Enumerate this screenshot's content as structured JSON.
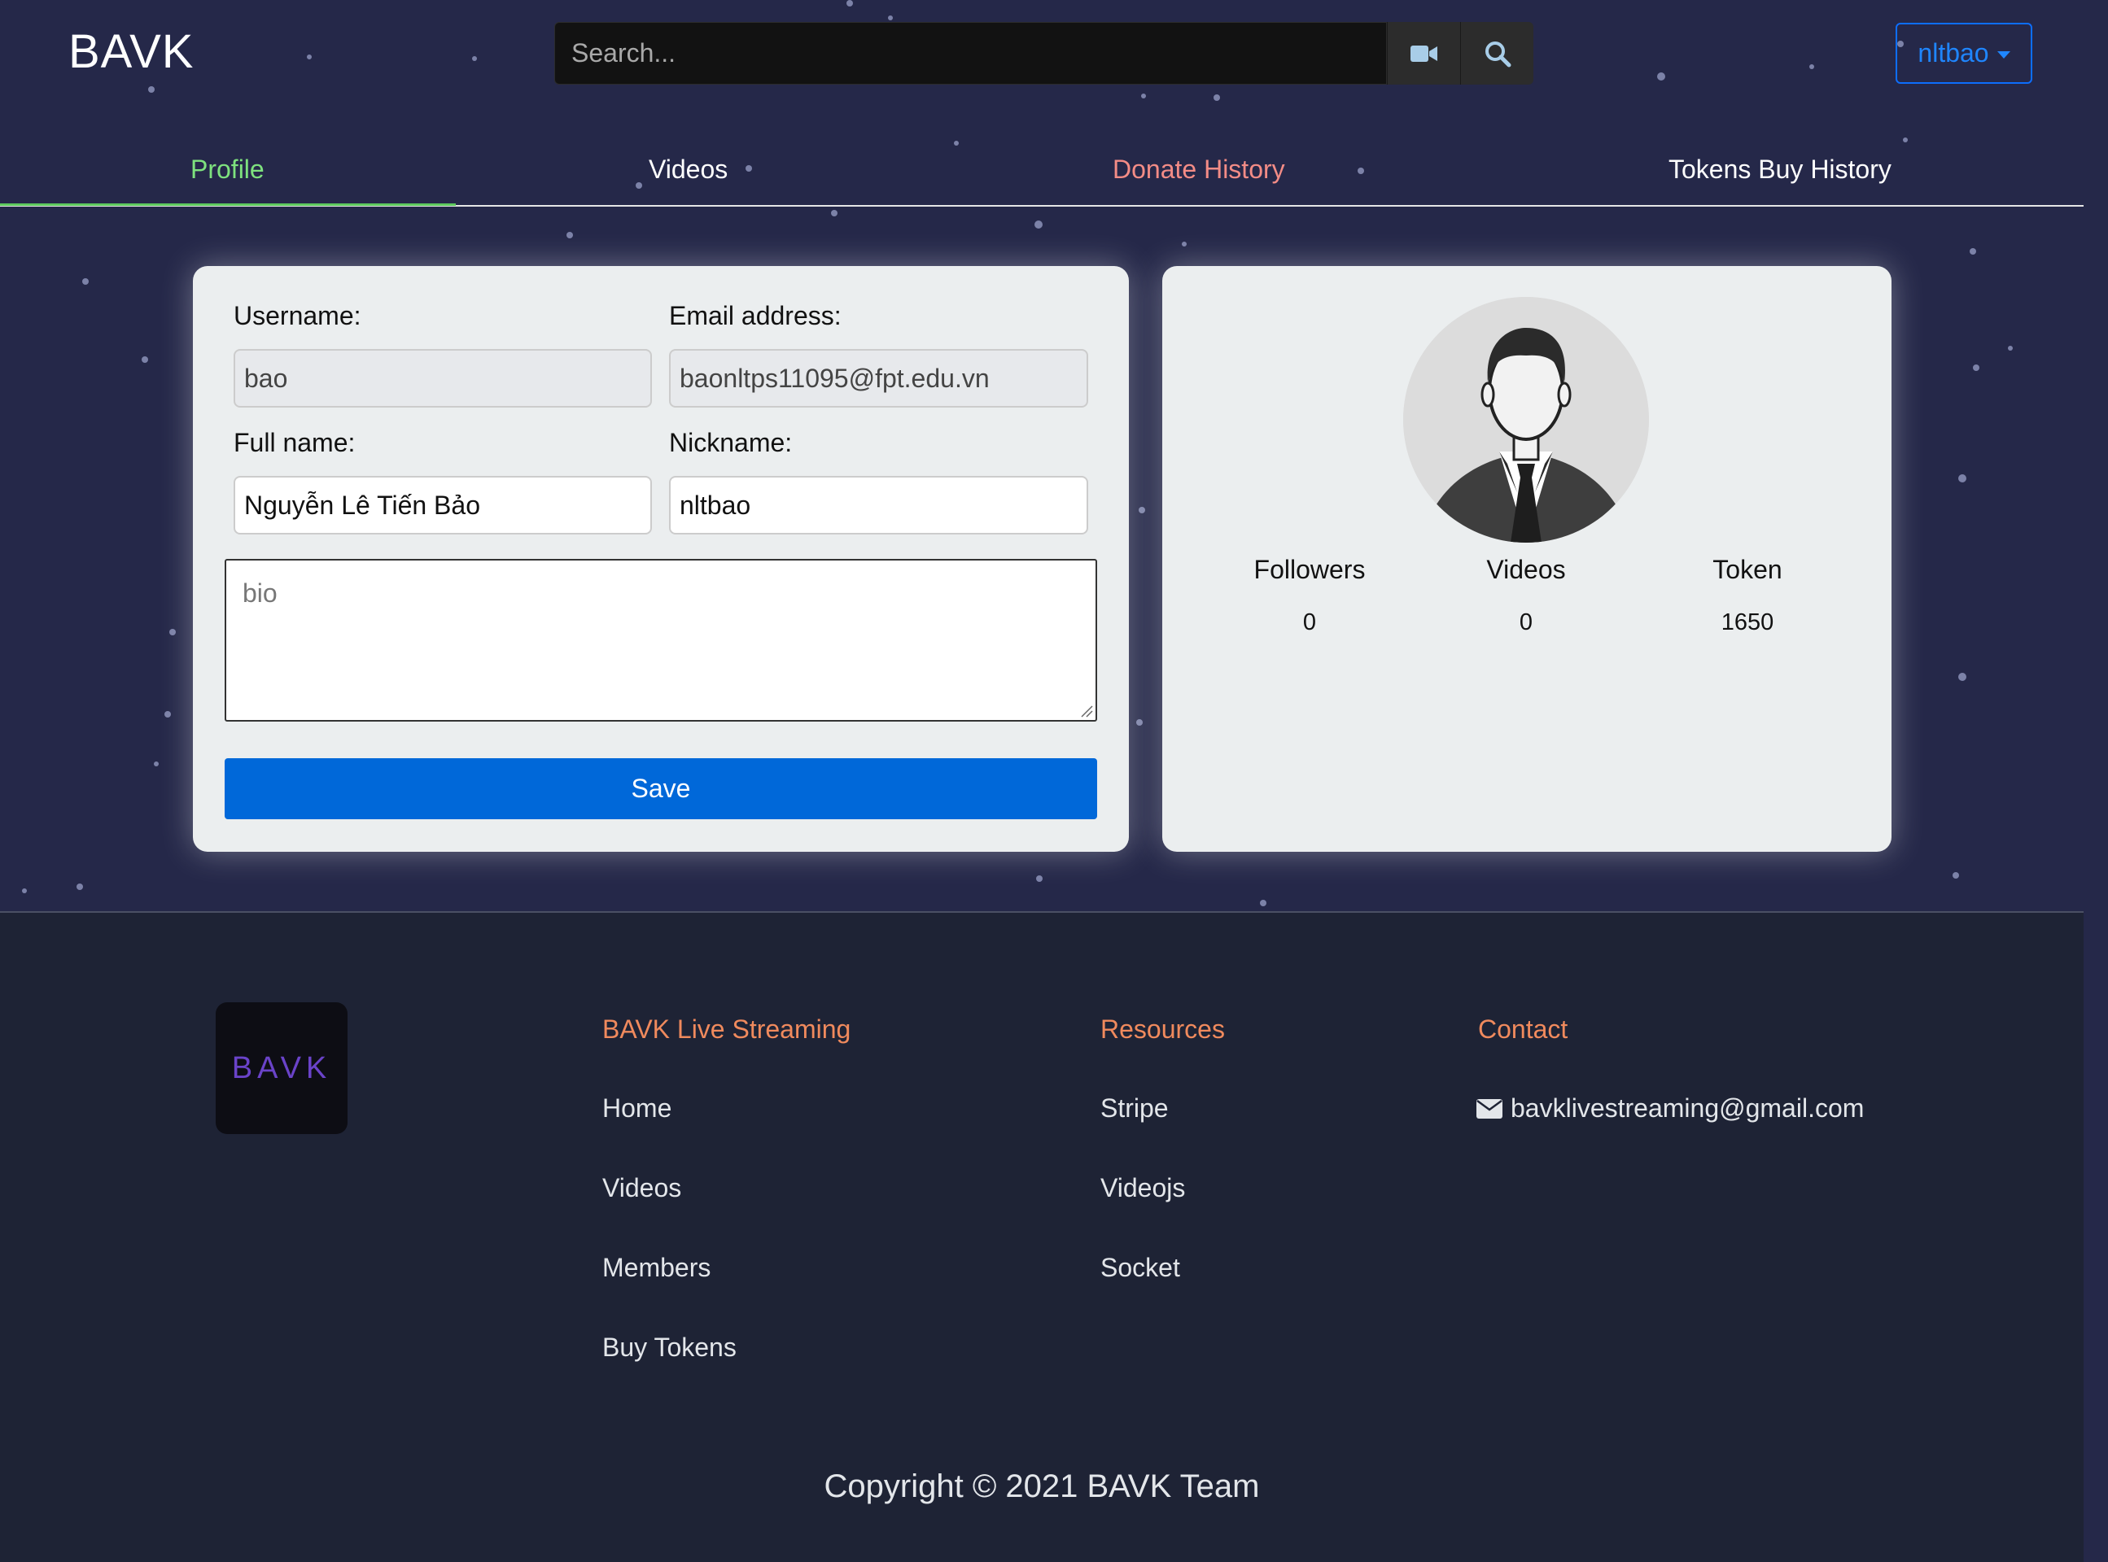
{
  "header": {
    "logo": "BAVK",
    "search_placeholder": "Search...",
    "video_icon": "video-camera-icon",
    "search_icon": "magnifier-icon",
    "user_label": "nltbao"
  },
  "tabs": [
    {
      "label": "Profile",
      "active": true
    },
    {
      "label": "Videos"
    },
    {
      "label": "Donate History"
    },
    {
      "label": "Tokens Buy History"
    }
  ],
  "form": {
    "username_label": "Username:",
    "username_value": "bao",
    "email_label": "Email address:",
    "email_value": "baonltps11095@fpt.edu.vn",
    "fullname_label": "Full name:",
    "fullname_value": "Nguyễn Lê Tiến Bảo",
    "nickname_label": "Nickname:",
    "nickname_value": "nltbao",
    "bio_placeholder": "bio",
    "save_label": "Save"
  },
  "stats": [
    {
      "label": "Followers",
      "value": "0"
    },
    {
      "label": "Videos",
      "value": "0"
    },
    {
      "label": "Token",
      "value": "1650"
    }
  ],
  "footer": {
    "logo_text": "BAVK",
    "columns": [
      {
        "heading": "BAVK Live Streaming",
        "links": [
          "Home",
          "Videos",
          "Members",
          "Buy Tokens"
        ]
      },
      {
        "heading": "Resources",
        "links": [
          "Stripe",
          "Videojs",
          "Socket"
        ]
      },
      {
        "heading": "Contact",
        "email": "bavklivestreaming@gmail.com"
      }
    ],
    "copyright": "Copyright © 2021 BAVK Team"
  },
  "colors": {
    "background": "#252849",
    "footer_background": "#1e2335",
    "active_tab": "#7ee27e",
    "donate_tab": "#f38c86",
    "footer_heading": "#f08a5d",
    "save_button": "#0068d9",
    "user_button": "#0d6efd"
  }
}
